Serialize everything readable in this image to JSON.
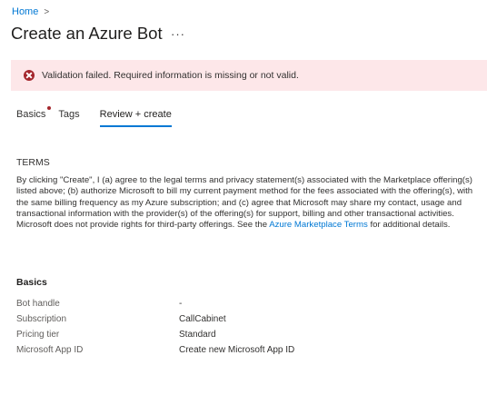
{
  "breadcrumb": {
    "home": "Home",
    "separator": ">"
  },
  "page": {
    "title": "Create an Azure Bot",
    "more": "···"
  },
  "banner": {
    "message": "Validation failed. Required information is missing or not valid."
  },
  "tabs": [
    {
      "label": "Basics",
      "has_error": true
    },
    {
      "label": "Tags"
    },
    {
      "label": "Review + create",
      "active": true
    }
  ],
  "terms": {
    "title": "TERMS",
    "body_text": "By clicking \"Create\", I (a) agree to the legal terms and privacy statement(s) associated with the Marketplace offering(s) listed above; (b) authorize Microsoft to bill my current payment method for the fees associated with the offering(s), with the same billing frequency as my Azure subscription; and (c) agree that Microsoft may share my contact, usage and transactional information with the provider(s) of the offering(s) for support, billing and other transactional activities. Microsoft does not provide rights for third-party offerings. See the",
    "link_text": "Azure Marketplace Terms",
    "tail_text": "for additional details."
  },
  "basics": {
    "title": "Basics",
    "rows": [
      {
        "label": "Bot handle",
        "value": "-"
      },
      {
        "label": "Subscription",
        "value": "CallCabinet"
      },
      {
        "label": "Pricing tier",
        "value": "Standard"
      },
      {
        "label": "Microsoft App ID",
        "value": "Create new Microsoft App ID"
      }
    ]
  },
  "colors": {
    "accent": "#0078d4",
    "error": "#a4262c",
    "error_bg": "#fde7e9"
  }
}
